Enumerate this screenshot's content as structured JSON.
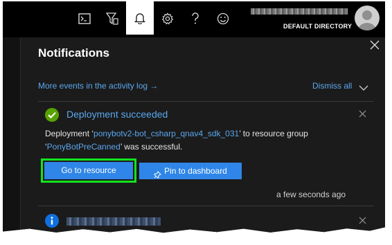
{
  "header": {
    "directory_label": "DEFAULT DIRECTORY",
    "icons": [
      "cloud-shell-icon",
      "directory-filter-icon",
      "bell-icon",
      "gear-icon",
      "help-icon",
      "feedback-smiley-icon"
    ]
  },
  "panel": {
    "title": "Notifications",
    "more_events_link": "More events in the activity log",
    "more_events_arrow": "→",
    "dismiss_all": "Dismiss all"
  },
  "notifications": [
    {
      "status": "success",
      "title": "Deployment succeeded",
      "body_prefix": "Deployment ‘",
      "deployment_name": "ponybotv2-bot_csharp_qnav4_sdk_031",
      "body_middle": "’ to resource group ‘",
      "resource_group": "PonyBotPreCanned",
      "body_suffix": "’ was successful.",
      "primary_button": "Go to resource",
      "secondary_button": "Pin to dashboard",
      "timestamp": "a few seconds ago"
    },
    {
      "status": "info"
    }
  ],
  "colors": {
    "accent_link": "#5aa7ee",
    "button_blue": "#2f86e8",
    "highlight_green": "#11e41e",
    "success_green": "#57a300",
    "info_blue": "#0f6fe0",
    "panel_bg": "#1b1b1b"
  }
}
